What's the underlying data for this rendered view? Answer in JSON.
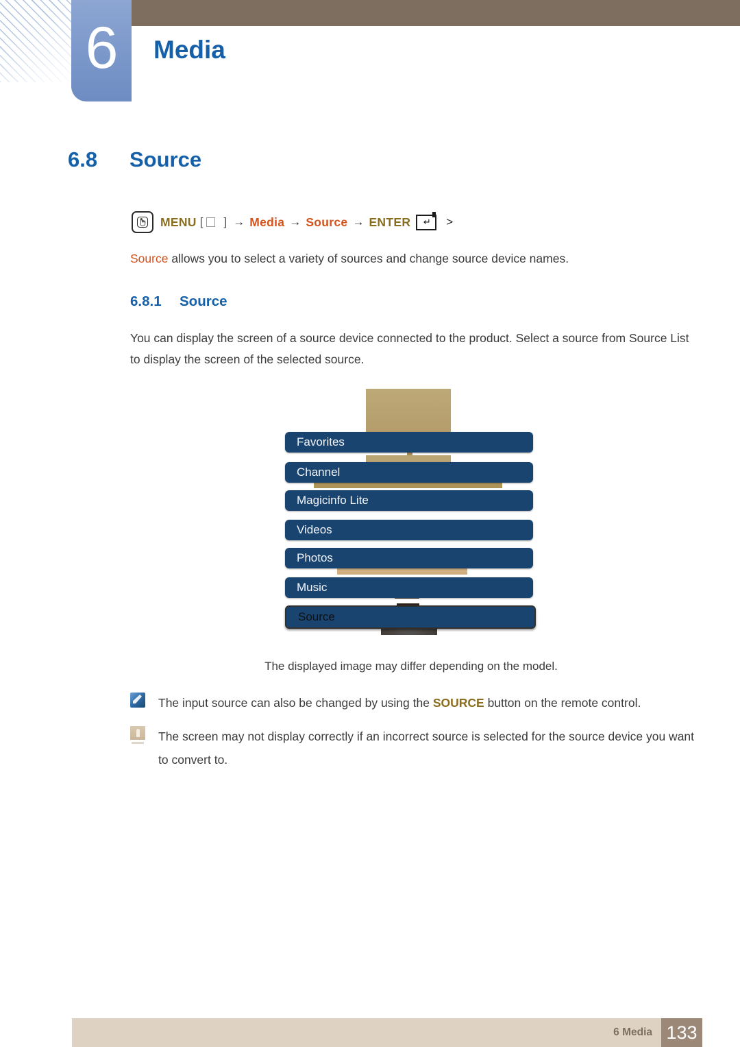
{
  "chapter": {
    "number": "6",
    "title": "Media"
  },
  "section": {
    "number": "6.8",
    "title": "Source"
  },
  "menu_path": {
    "menu_icon": "hand-press-icon",
    "menu_label": "MENU",
    "bracket_open": "[",
    "bracket_close": "]",
    "arrow": "→",
    "step_media": "Media",
    "step_source": "Source",
    "enter_label": "ENTER",
    "enter_icon": "enter-key-icon",
    "trailing": ">"
  },
  "intro": {
    "highlight": "Source",
    "rest": " allows you to select a variety of sources and change source device names."
  },
  "subsection": {
    "number": "6.8.1",
    "title": "Source"
  },
  "body_text": "You can display the screen of a source device connected to the product. Select a source from Source List to display the screen of the selected source.",
  "illustration": {
    "items": [
      {
        "label": "Favorites",
        "selected": false
      },
      {
        "label": "Channel",
        "selected": false
      },
      {
        "label": "Magicinfo Lite",
        "selected": false
      },
      {
        "label": "Videos",
        "selected": false
      },
      {
        "label": "Photos",
        "selected": false
      },
      {
        "label": "Music",
        "selected": false
      },
      {
        "label": "Source",
        "selected": true
      }
    ],
    "bar_color": "#1a4470",
    "selected_text_color": "#101010",
    "overlay_color": "#b9a270"
  },
  "caption": "The displayed image may differ depending on the model.",
  "notes": [
    {
      "icon": "note-icon",
      "before": "The input source can also be changed by using the ",
      "bold": "SOURCE",
      "after": " button on the remote control."
    },
    {
      "icon": "caution-icon",
      "before": "The screen may not display correctly if an incorrect source is selected for the source device you want to convert to.",
      "bold": "",
      "after": ""
    }
  ],
  "footer": {
    "label": "6 Media",
    "page": "133"
  },
  "colors": {
    "header_brown": "#7d6e5f",
    "chapter_blue": "#7e9acc",
    "heading_blue": "#1560a8",
    "accent_orange": "#d4521c",
    "accent_gold": "#8a6d1f",
    "footer_tan": "#ded2c2",
    "footer_page_brown": "#9b8877"
  }
}
